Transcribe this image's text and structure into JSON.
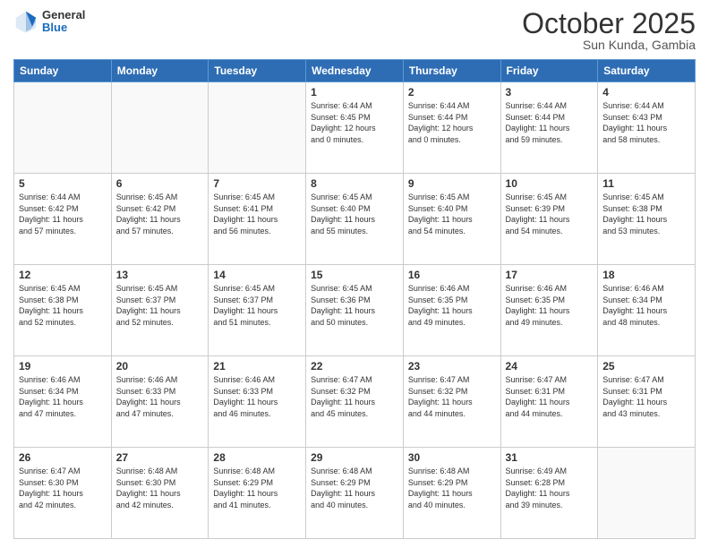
{
  "header": {
    "logo_general": "General",
    "logo_blue": "Blue",
    "month_title": "October 2025",
    "subtitle": "Sun Kunda, Gambia"
  },
  "days_of_week": [
    "Sunday",
    "Monday",
    "Tuesday",
    "Wednesday",
    "Thursday",
    "Friday",
    "Saturday"
  ],
  "weeks": [
    [
      {
        "day": "",
        "info": ""
      },
      {
        "day": "",
        "info": ""
      },
      {
        "day": "",
        "info": ""
      },
      {
        "day": "1",
        "info": "Sunrise: 6:44 AM\nSunset: 6:45 PM\nDaylight: 12 hours\nand 0 minutes."
      },
      {
        "day": "2",
        "info": "Sunrise: 6:44 AM\nSunset: 6:44 PM\nDaylight: 12 hours\nand 0 minutes."
      },
      {
        "day": "3",
        "info": "Sunrise: 6:44 AM\nSunset: 6:44 PM\nDaylight: 11 hours\nand 59 minutes."
      },
      {
        "day": "4",
        "info": "Sunrise: 6:44 AM\nSunset: 6:43 PM\nDaylight: 11 hours\nand 58 minutes."
      }
    ],
    [
      {
        "day": "5",
        "info": "Sunrise: 6:44 AM\nSunset: 6:42 PM\nDaylight: 11 hours\nand 57 minutes."
      },
      {
        "day": "6",
        "info": "Sunrise: 6:45 AM\nSunset: 6:42 PM\nDaylight: 11 hours\nand 57 minutes."
      },
      {
        "day": "7",
        "info": "Sunrise: 6:45 AM\nSunset: 6:41 PM\nDaylight: 11 hours\nand 56 minutes."
      },
      {
        "day": "8",
        "info": "Sunrise: 6:45 AM\nSunset: 6:40 PM\nDaylight: 11 hours\nand 55 minutes."
      },
      {
        "day": "9",
        "info": "Sunrise: 6:45 AM\nSunset: 6:40 PM\nDaylight: 11 hours\nand 54 minutes."
      },
      {
        "day": "10",
        "info": "Sunrise: 6:45 AM\nSunset: 6:39 PM\nDaylight: 11 hours\nand 54 minutes."
      },
      {
        "day": "11",
        "info": "Sunrise: 6:45 AM\nSunset: 6:38 PM\nDaylight: 11 hours\nand 53 minutes."
      }
    ],
    [
      {
        "day": "12",
        "info": "Sunrise: 6:45 AM\nSunset: 6:38 PM\nDaylight: 11 hours\nand 52 minutes."
      },
      {
        "day": "13",
        "info": "Sunrise: 6:45 AM\nSunset: 6:37 PM\nDaylight: 11 hours\nand 52 minutes."
      },
      {
        "day": "14",
        "info": "Sunrise: 6:45 AM\nSunset: 6:37 PM\nDaylight: 11 hours\nand 51 minutes."
      },
      {
        "day": "15",
        "info": "Sunrise: 6:45 AM\nSunset: 6:36 PM\nDaylight: 11 hours\nand 50 minutes."
      },
      {
        "day": "16",
        "info": "Sunrise: 6:46 AM\nSunset: 6:35 PM\nDaylight: 11 hours\nand 49 minutes."
      },
      {
        "day": "17",
        "info": "Sunrise: 6:46 AM\nSunset: 6:35 PM\nDaylight: 11 hours\nand 49 minutes."
      },
      {
        "day": "18",
        "info": "Sunrise: 6:46 AM\nSunset: 6:34 PM\nDaylight: 11 hours\nand 48 minutes."
      }
    ],
    [
      {
        "day": "19",
        "info": "Sunrise: 6:46 AM\nSunset: 6:34 PM\nDaylight: 11 hours\nand 47 minutes."
      },
      {
        "day": "20",
        "info": "Sunrise: 6:46 AM\nSunset: 6:33 PM\nDaylight: 11 hours\nand 47 minutes."
      },
      {
        "day": "21",
        "info": "Sunrise: 6:46 AM\nSunset: 6:33 PM\nDaylight: 11 hours\nand 46 minutes."
      },
      {
        "day": "22",
        "info": "Sunrise: 6:47 AM\nSunset: 6:32 PM\nDaylight: 11 hours\nand 45 minutes."
      },
      {
        "day": "23",
        "info": "Sunrise: 6:47 AM\nSunset: 6:32 PM\nDaylight: 11 hours\nand 44 minutes."
      },
      {
        "day": "24",
        "info": "Sunrise: 6:47 AM\nSunset: 6:31 PM\nDaylight: 11 hours\nand 44 minutes."
      },
      {
        "day": "25",
        "info": "Sunrise: 6:47 AM\nSunset: 6:31 PM\nDaylight: 11 hours\nand 43 minutes."
      }
    ],
    [
      {
        "day": "26",
        "info": "Sunrise: 6:47 AM\nSunset: 6:30 PM\nDaylight: 11 hours\nand 42 minutes."
      },
      {
        "day": "27",
        "info": "Sunrise: 6:48 AM\nSunset: 6:30 PM\nDaylight: 11 hours\nand 42 minutes."
      },
      {
        "day": "28",
        "info": "Sunrise: 6:48 AM\nSunset: 6:29 PM\nDaylight: 11 hours\nand 41 minutes."
      },
      {
        "day": "29",
        "info": "Sunrise: 6:48 AM\nSunset: 6:29 PM\nDaylight: 11 hours\nand 40 minutes."
      },
      {
        "day": "30",
        "info": "Sunrise: 6:48 AM\nSunset: 6:29 PM\nDaylight: 11 hours\nand 40 minutes."
      },
      {
        "day": "31",
        "info": "Sunrise: 6:49 AM\nSunset: 6:28 PM\nDaylight: 11 hours\nand 39 minutes."
      },
      {
        "day": "",
        "info": ""
      }
    ]
  ]
}
